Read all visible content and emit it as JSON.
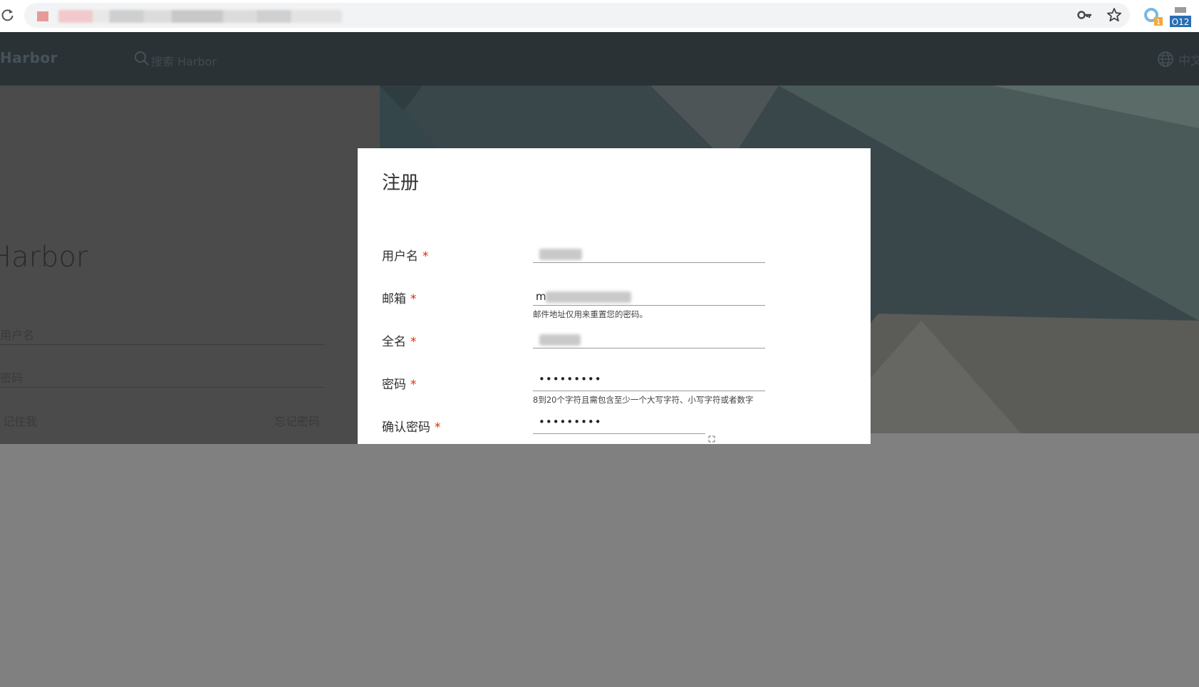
{
  "browser": {
    "icons": [
      "reload-icon",
      "key-icon",
      "star-icon",
      "extension-icon",
      "extension-icon"
    ],
    "extension_badge_a": "1",
    "extension_badge_b": "O12"
  },
  "header": {
    "brand": "Harbor",
    "search_placeholder": "搜索 Harbor",
    "language": "中文"
  },
  "login": {
    "title": "Harbor",
    "username_placeholder": "用户名",
    "password_placeholder": "密码",
    "remember_me": "记住我",
    "forgot_password": "忘记密码"
  },
  "modal": {
    "title": "注册",
    "required_mark": "*",
    "fields": [
      {
        "label": "用户名",
        "value": "",
        "helper": ""
      },
      {
        "label": "邮箱",
        "value": "m",
        "helper": "邮件地址仅用来重置您的密码。"
      },
      {
        "label": "全名",
        "value": "",
        "helper": ""
      },
      {
        "label": "密码",
        "value": "•••••••••",
        "helper": "8到20个字符且需包含至少一个大写字符、小写字符或者数字"
      },
      {
        "label": "确认密码",
        "value": "•••••••••",
        "helper": ""
      }
    ]
  },
  "colors": {
    "header_bg": "#2b3236",
    "required": "#e62700",
    "overlay": "#808080"
  }
}
